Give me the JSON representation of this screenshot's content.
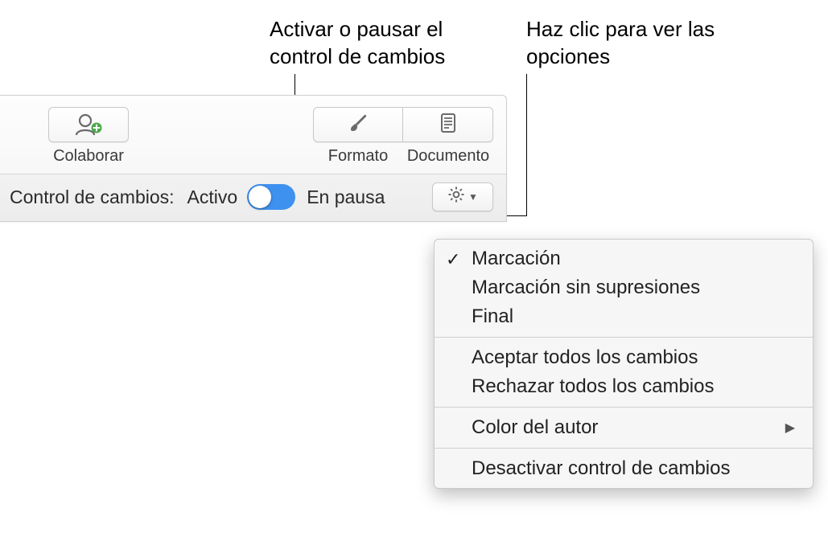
{
  "annotations": {
    "toggle_callout": "Activar o pausar el control de cambios",
    "gear_callout": "Haz clic para ver las opciones"
  },
  "toolbar": {
    "collaborate_label": "Colaborar",
    "format_label": "Formato",
    "document_label": "Documento"
  },
  "trackbar": {
    "title": "Control de cambios:",
    "active": "Activo",
    "paused": "En pausa"
  },
  "menu": {
    "markup": "Marcación",
    "markup_no_del": "Marcación sin supresiones",
    "final": "Final",
    "accept_all": "Aceptar todos los cambios",
    "reject_all": "Rechazar todos los cambios",
    "author_color": "Color del autor",
    "disable_tracking": "Desactivar control de cambios"
  },
  "icons": {
    "collaborate": "collaborate-icon",
    "brush": "brush-icon",
    "document": "document-icon",
    "gear": "gear-icon",
    "chevron_down": "chevron-down-icon",
    "chevron_right": "chevron-right-icon",
    "checkmark": "checkmark-icon"
  },
  "colors": {
    "toggle_on": "#3f91f0"
  }
}
